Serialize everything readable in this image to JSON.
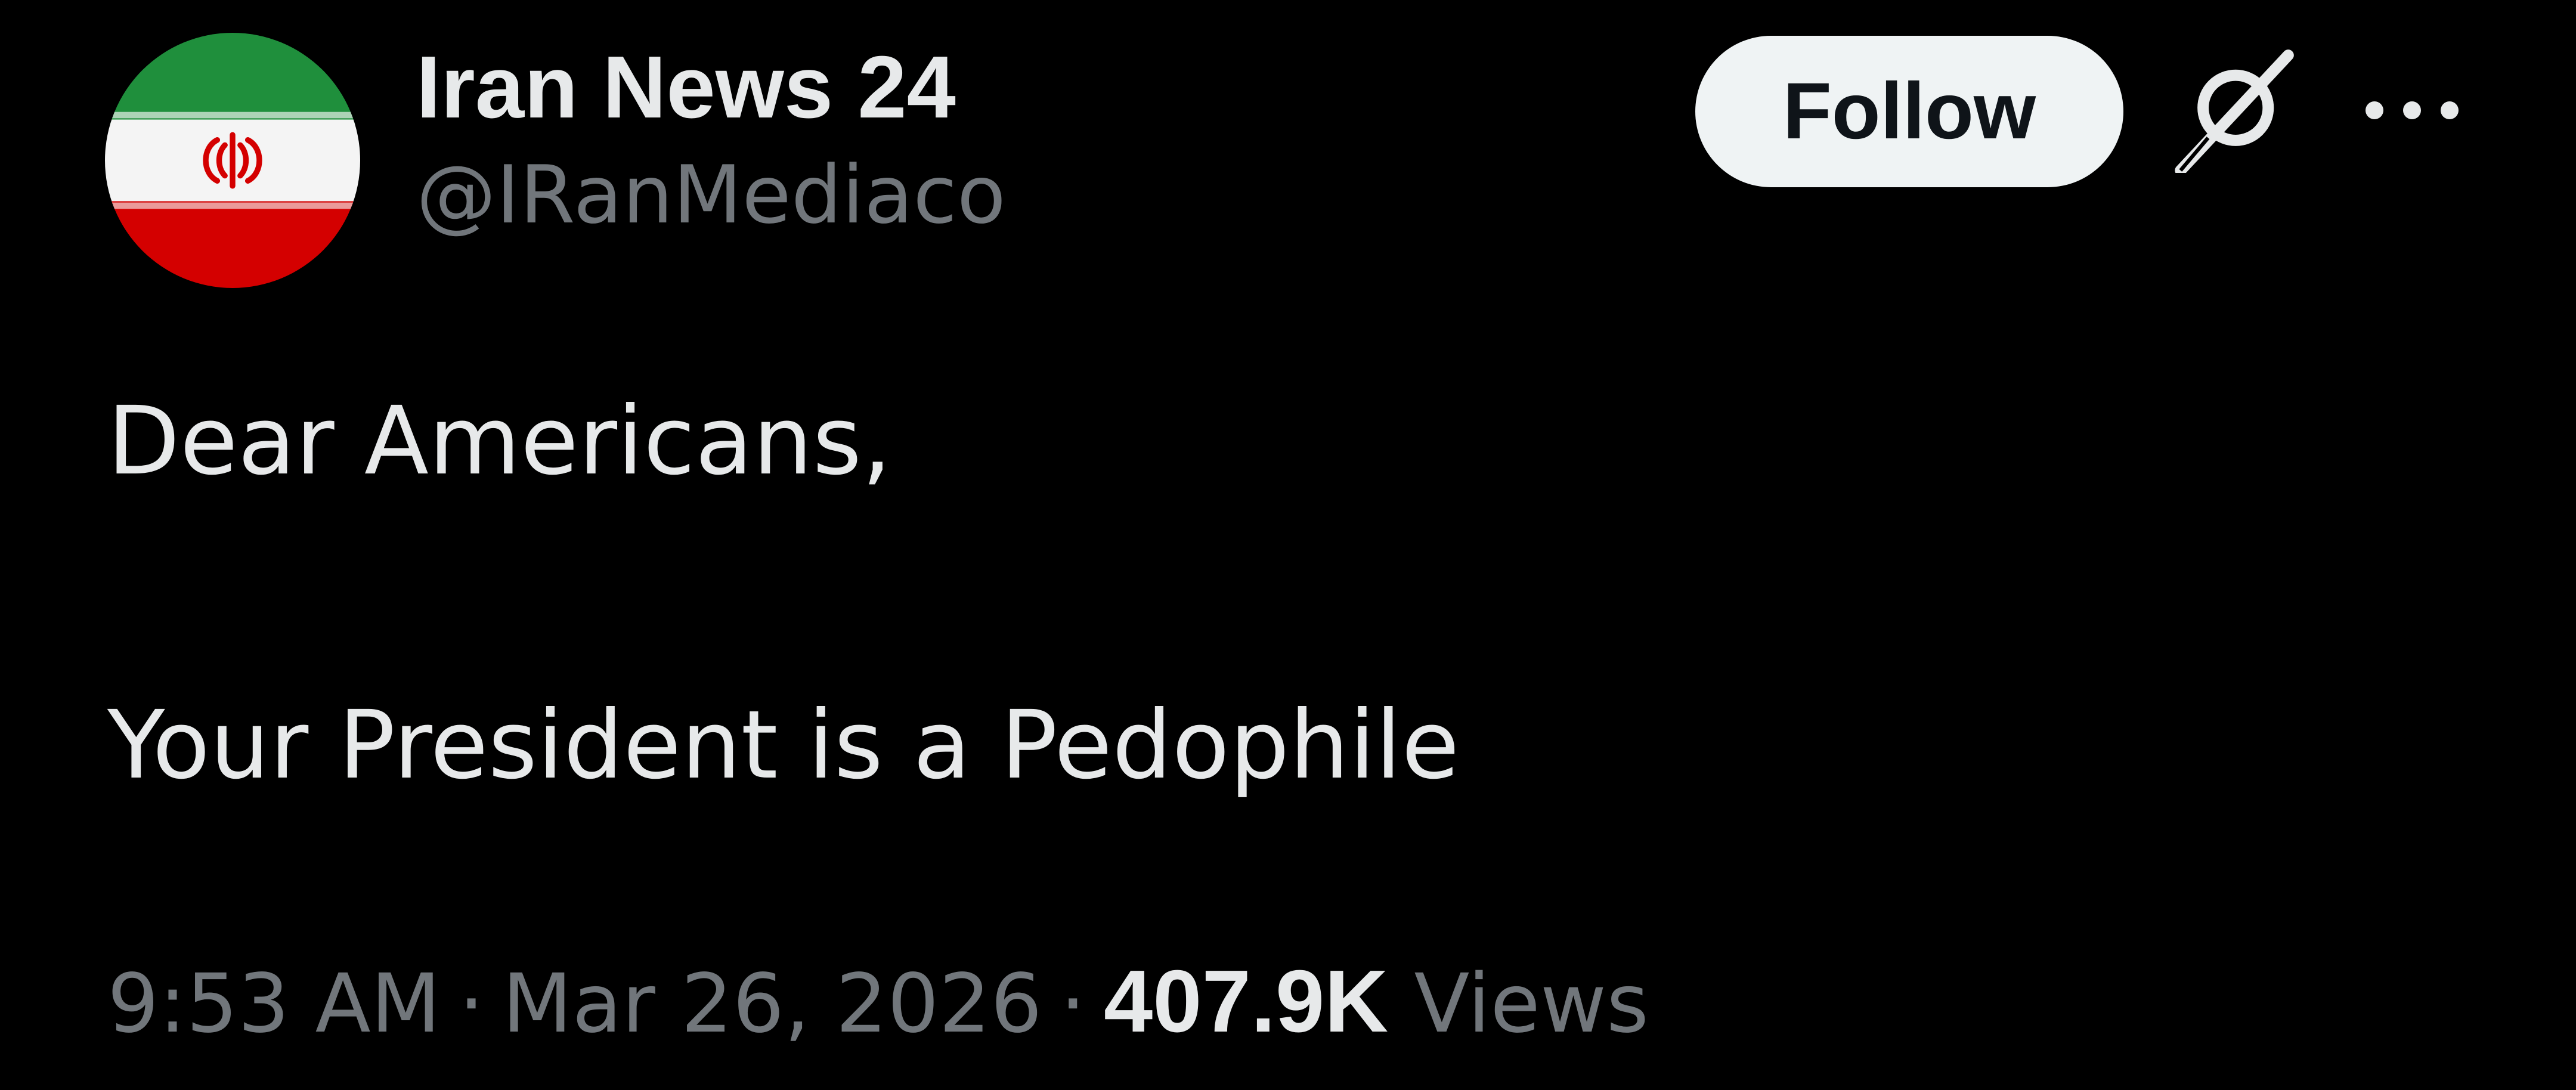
{
  "account": {
    "display_name": "Iran News 24",
    "handle": "@IRanMediaco",
    "avatar_icon": "iran-flag-avatar"
  },
  "actions": {
    "follow_label": "Follow",
    "grok_icon": "grok-icon",
    "more_icon": "more-options-icon"
  },
  "tweet": {
    "line1": "Dear Americans,",
    "line2": "Your President is a Pedophile"
  },
  "meta": {
    "time": "9:53 AM",
    "separator": "·",
    "date": "Mar 26, 2026",
    "views_count": "407.9K",
    "views_label": "Views"
  },
  "colors": {
    "background": "#000000",
    "primary_text": "#e7e9ea",
    "secondary_text": "#71767b",
    "follow_bg": "#eff3f4",
    "follow_text": "#0f1419",
    "flag_green": "#239f40",
    "flag_white": "#ffffff",
    "flag_red": "#da0000"
  }
}
